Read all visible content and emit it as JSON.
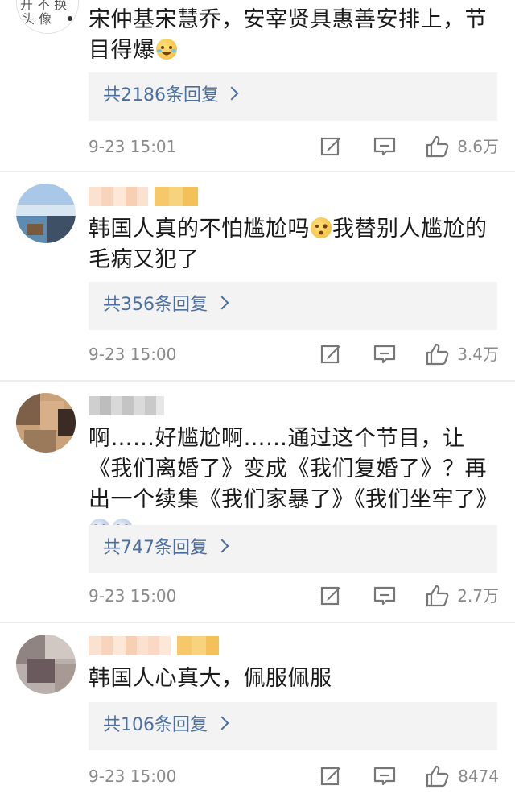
{
  "comments": [
    {
      "text": "宋仲基宋慧乔，安宰贤具惠善安排上，节目得爆",
      "avatar_text": "开不换头像",
      "reply": "共2186条回复",
      "time": "9-23 15:01",
      "likes": "8.6万"
    },
    {
      "text_a": "韩国人真的不怕尴尬吗",
      "text_b": "我替别人尴尬的毛病又犯了",
      "reply": "共356条回复",
      "time": "9-23 15:00",
      "likes": "3.4万"
    },
    {
      "text": "啊……好尴尬啊……通过这个节目，让《我们离婚了》变成《我们复婚了》？再出一个续集《我们家暴了》《我们坐牢了》",
      "reply": "共747条回复",
      "time": "9-23 15:00",
      "likes": "2.7万"
    },
    {
      "text": "韩国人心真大，佩服佩服",
      "reply": "共106条回复",
      "time": "9-23 15:00",
      "likes": "8474"
    }
  ],
  "icons": {
    "edit": "edit-icon",
    "comment": "comment-icon",
    "like": "thumbs-up-icon",
    "chevron": "chevron-right-icon"
  },
  "colors": {
    "link": "#4a6fa0",
    "meta": "#8a8a8a",
    "reply_bg": "#f3f3f3"
  }
}
